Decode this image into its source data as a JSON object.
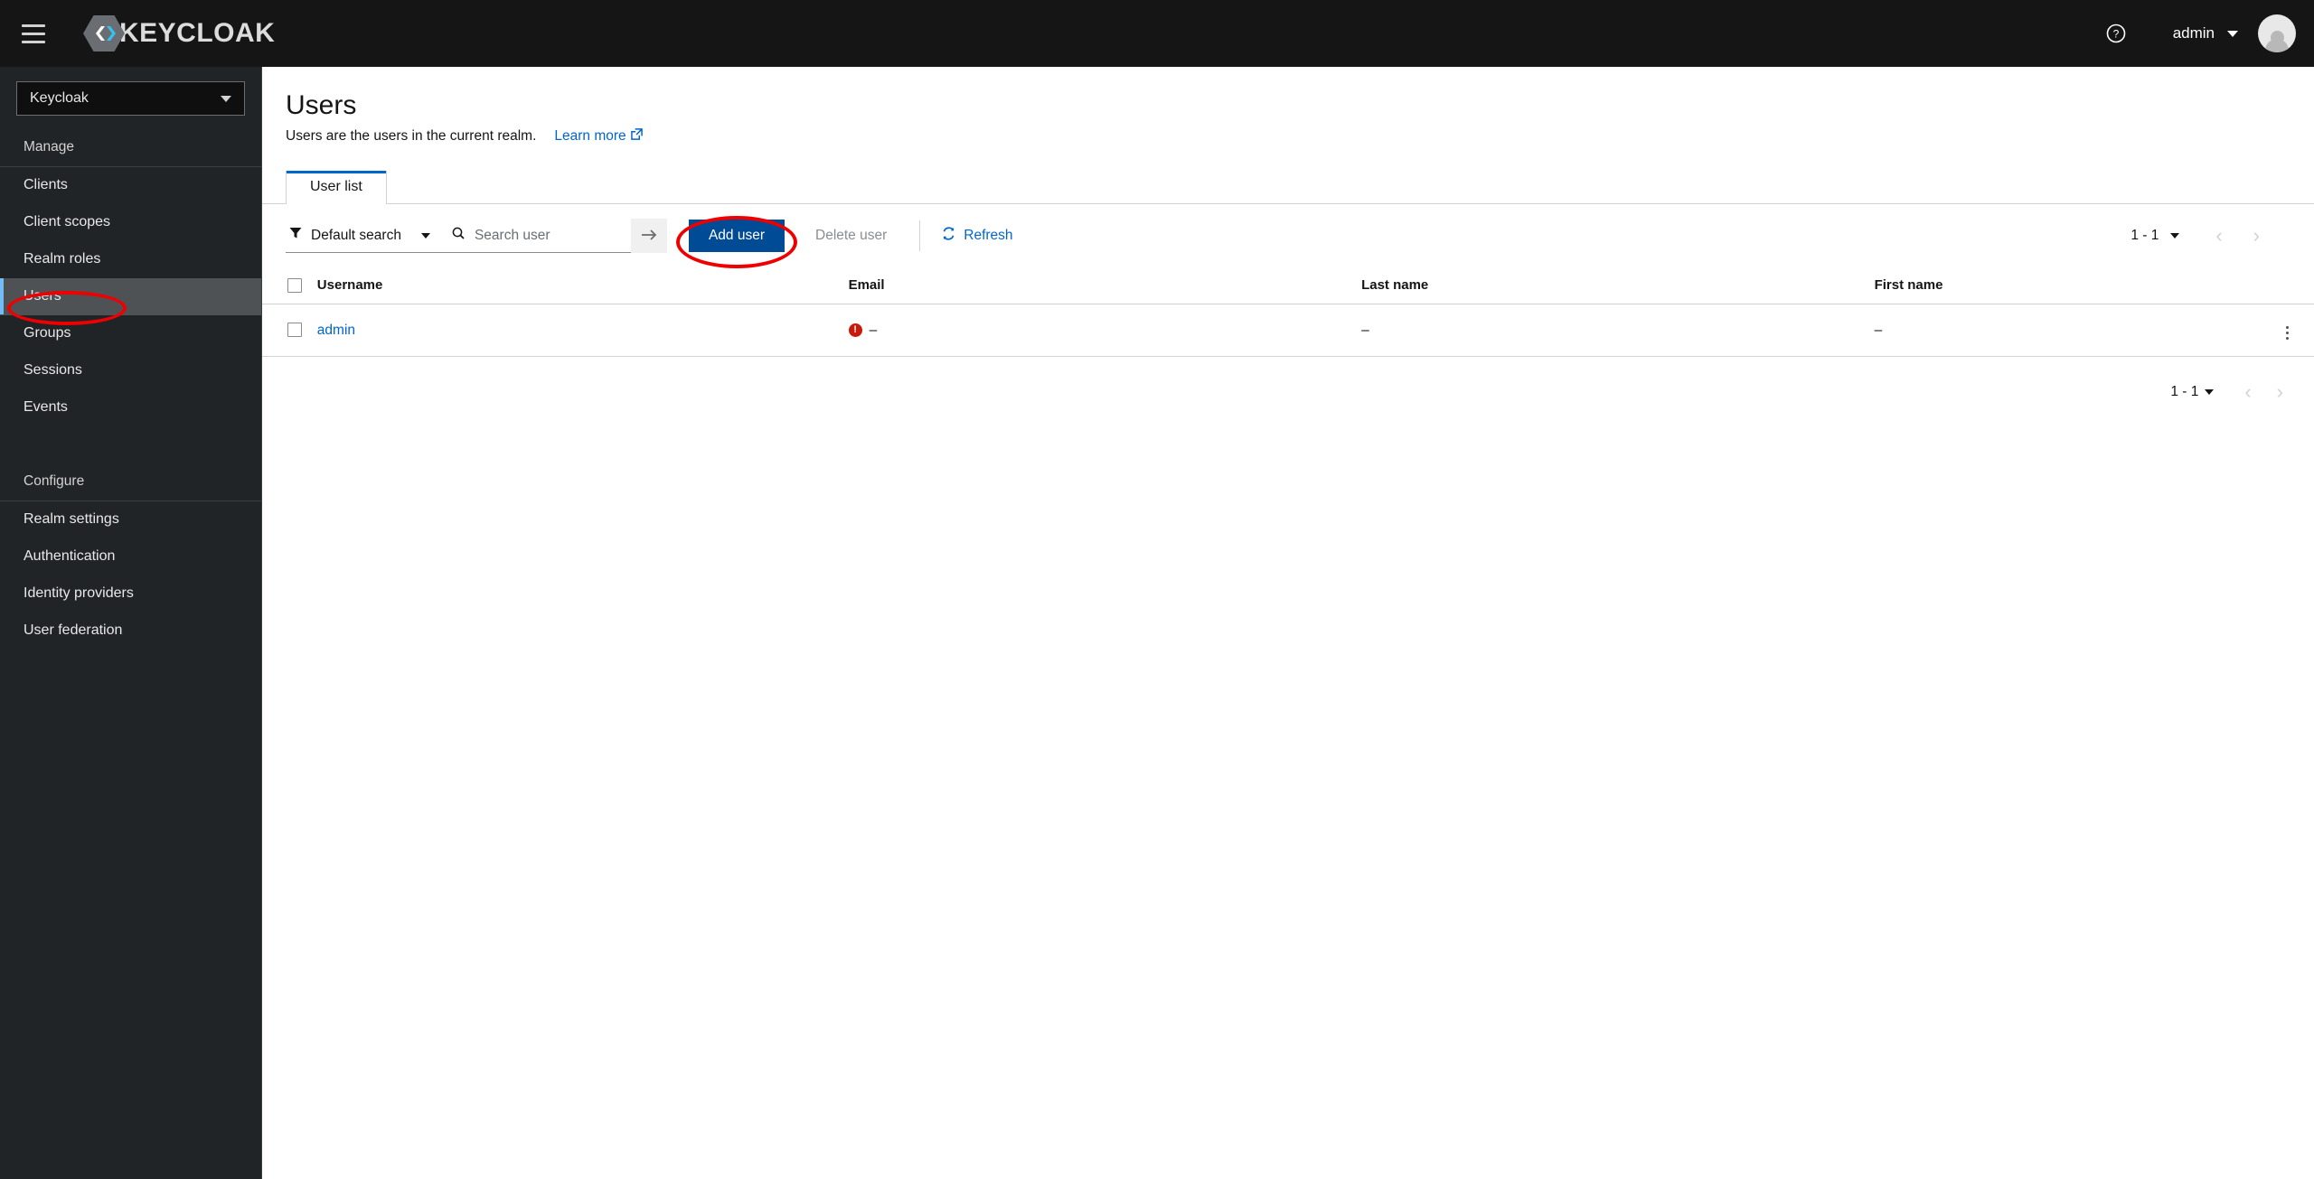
{
  "masthead": {
    "hamburger_icon": "hamburger-menu-icon",
    "brand_text": "KEYCLOAK",
    "help_icon": "help-circle-icon",
    "user_name": "admin",
    "avatar_icon": "user-avatar-icon"
  },
  "sidebar": {
    "realm_selector": {
      "value": "Keycloak",
      "caret_icon": "chevron-down-icon"
    },
    "groups": [
      {
        "title": "Manage",
        "items": [
          {
            "label": "Clients",
            "active": false
          },
          {
            "label": "Client scopes",
            "active": false
          },
          {
            "label": "Realm roles",
            "active": false
          },
          {
            "label": "Users",
            "active": true
          },
          {
            "label": "Groups",
            "active": false
          },
          {
            "label": "Sessions",
            "active": false
          },
          {
            "label": "Events",
            "active": false
          }
        ]
      },
      {
        "title": "Configure",
        "items": [
          {
            "label": "Realm settings",
            "active": false
          },
          {
            "label": "Authentication",
            "active": false
          },
          {
            "label": "Identity providers",
            "active": false
          },
          {
            "label": "User federation",
            "active": false
          }
        ]
      }
    ]
  },
  "page": {
    "title": "Users",
    "description": "Users are the users in the current realm.",
    "learn_more": "Learn more",
    "learn_more_icon": "external-link-icon"
  },
  "tabs": [
    {
      "label": "User list",
      "active": true
    }
  ],
  "toolbar": {
    "filter": {
      "icon": "filter-icon",
      "label": "Default search",
      "caret_icon": "chevron-down-icon"
    },
    "search": {
      "icon": "search-icon",
      "value": "",
      "placeholder": "Search user",
      "submit_icon": "arrow-right-icon"
    },
    "add_user_label": "Add user",
    "delete_user_label": "Delete user",
    "delete_user_disabled": true,
    "refresh_label": "Refresh",
    "refresh_icon": "refresh-icon"
  },
  "pagination_top": {
    "range": "1 - 1",
    "caret_icon": "chevron-down-icon",
    "prev_icon": "chevron-left-icon",
    "next_icon": "chevron-right-icon"
  },
  "pagination_bottom": {
    "range": "1 - 1",
    "caret_icon": "chevron-down-icon",
    "prev_icon": "chevron-left-icon",
    "next_icon": "chevron-right-icon"
  },
  "table": {
    "columns": [
      "Username",
      "Email",
      "Last name",
      "First name"
    ],
    "rows": [
      {
        "username": "admin",
        "email": "–",
        "email_warning_icon": "error-exclamation-icon",
        "email_has_warning": true,
        "last_name": "–",
        "first_name": "–",
        "kebab_icon": "kebab-menu-icon"
      }
    ]
  },
  "annotations": {
    "accent_color": "#ee0000",
    "highlights": [
      "sidebar-item-users",
      "add-user-button"
    ]
  },
  "colors": {
    "masthead_bg": "#151515",
    "sidebar_bg": "#212427",
    "active_nav_bg": "#4f5255",
    "active_nav_border": "#73bcf7",
    "primary_button": "#004b95",
    "link": "#0066cc",
    "error": "#c9190b",
    "tab_active_border": "#0066cc"
  }
}
